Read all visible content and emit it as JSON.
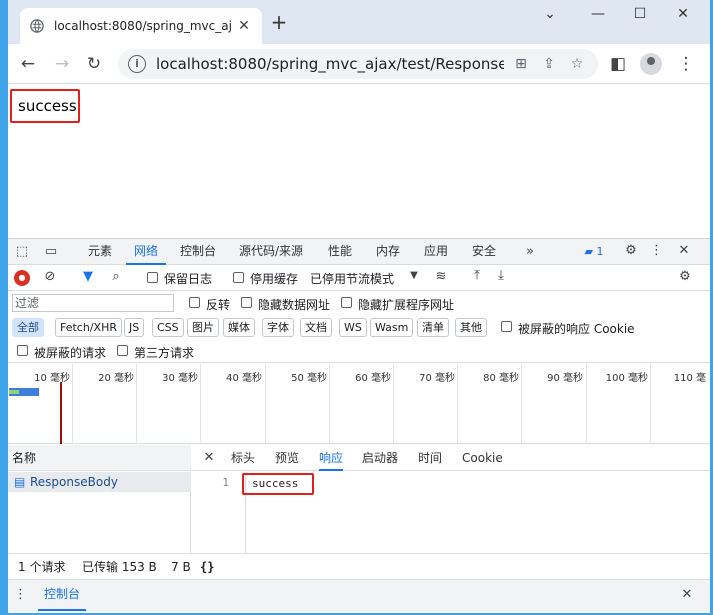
{
  "browser": {
    "tab_title": "localhost:8080/spring_mvc_aj",
    "url": "localhost:8080/spring_mvc_ajax/test/ResponseBody"
  },
  "page": {
    "body_text": "success"
  },
  "devtools": {
    "panels": [
      "元素",
      "网络",
      "控制台",
      "源代码/来源",
      "性能",
      "内存",
      "应用",
      "安全"
    ],
    "active_panel": "网络",
    "issues_count": "1",
    "toolbar": {
      "preserve_log": "保留日志",
      "disable_cache": "停用缓存",
      "throttling": "已停用节流模式"
    },
    "filter": {
      "placeholder": "过滤",
      "invert": "反转",
      "hide_data_urls": "隐藏数据网址",
      "hide_extension_urls": "隐藏扩展程序网址"
    },
    "type_filters": [
      "全部",
      "Fetch/XHR",
      "JS",
      "CSS",
      "图片",
      "媒体",
      "字体",
      "文档",
      "WS",
      "Wasm",
      "清单",
      "其他"
    ],
    "blocked_response_cookies": "被屏蔽的响应 Cookie",
    "blocked_requests": "被屏蔽的请求",
    "third_party_requests": "第三方请求",
    "timeline_ticks": [
      "10 毫秒",
      "20 毫秒",
      "30 毫秒",
      "40 毫秒",
      "50 毫秒",
      "60 毫秒",
      "70 毫秒",
      "80 毫秒",
      "90 毫秒",
      "100 毫秒",
      "110 毫"
    ],
    "request_list": {
      "header": "名称",
      "rows": [
        "ResponseBody"
      ]
    },
    "detail_tabs": [
      "标头",
      "预览",
      "响应",
      "启动器",
      "时间",
      "Cookie"
    ],
    "active_detail_tab": "响应",
    "response": {
      "line_number": "1",
      "content": "success"
    },
    "status_bar": {
      "requests": "1 个请求",
      "transferred": "已传输 153 B",
      "resources": "7 B"
    },
    "drawer": {
      "tab": "控制台"
    },
    "colors": {
      "accent": "#1a73e8",
      "highlight": "#e0201c",
      "frame": "#3ea3e8"
    }
  }
}
